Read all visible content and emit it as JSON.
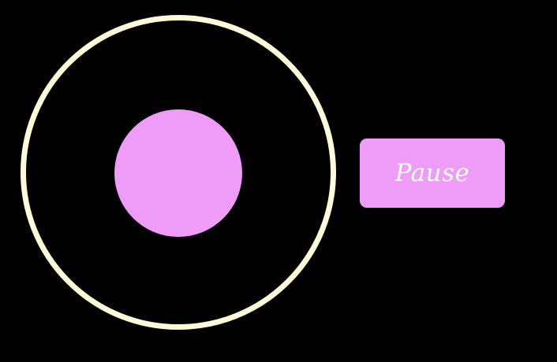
{
  "colors": {
    "background": "#000000",
    "ring": "#fffbd8",
    "accent": "#ef9bf8",
    "button_text": "#ffffff"
  },
  "controls": {
    "pause_label": "Pause"
  }
}
